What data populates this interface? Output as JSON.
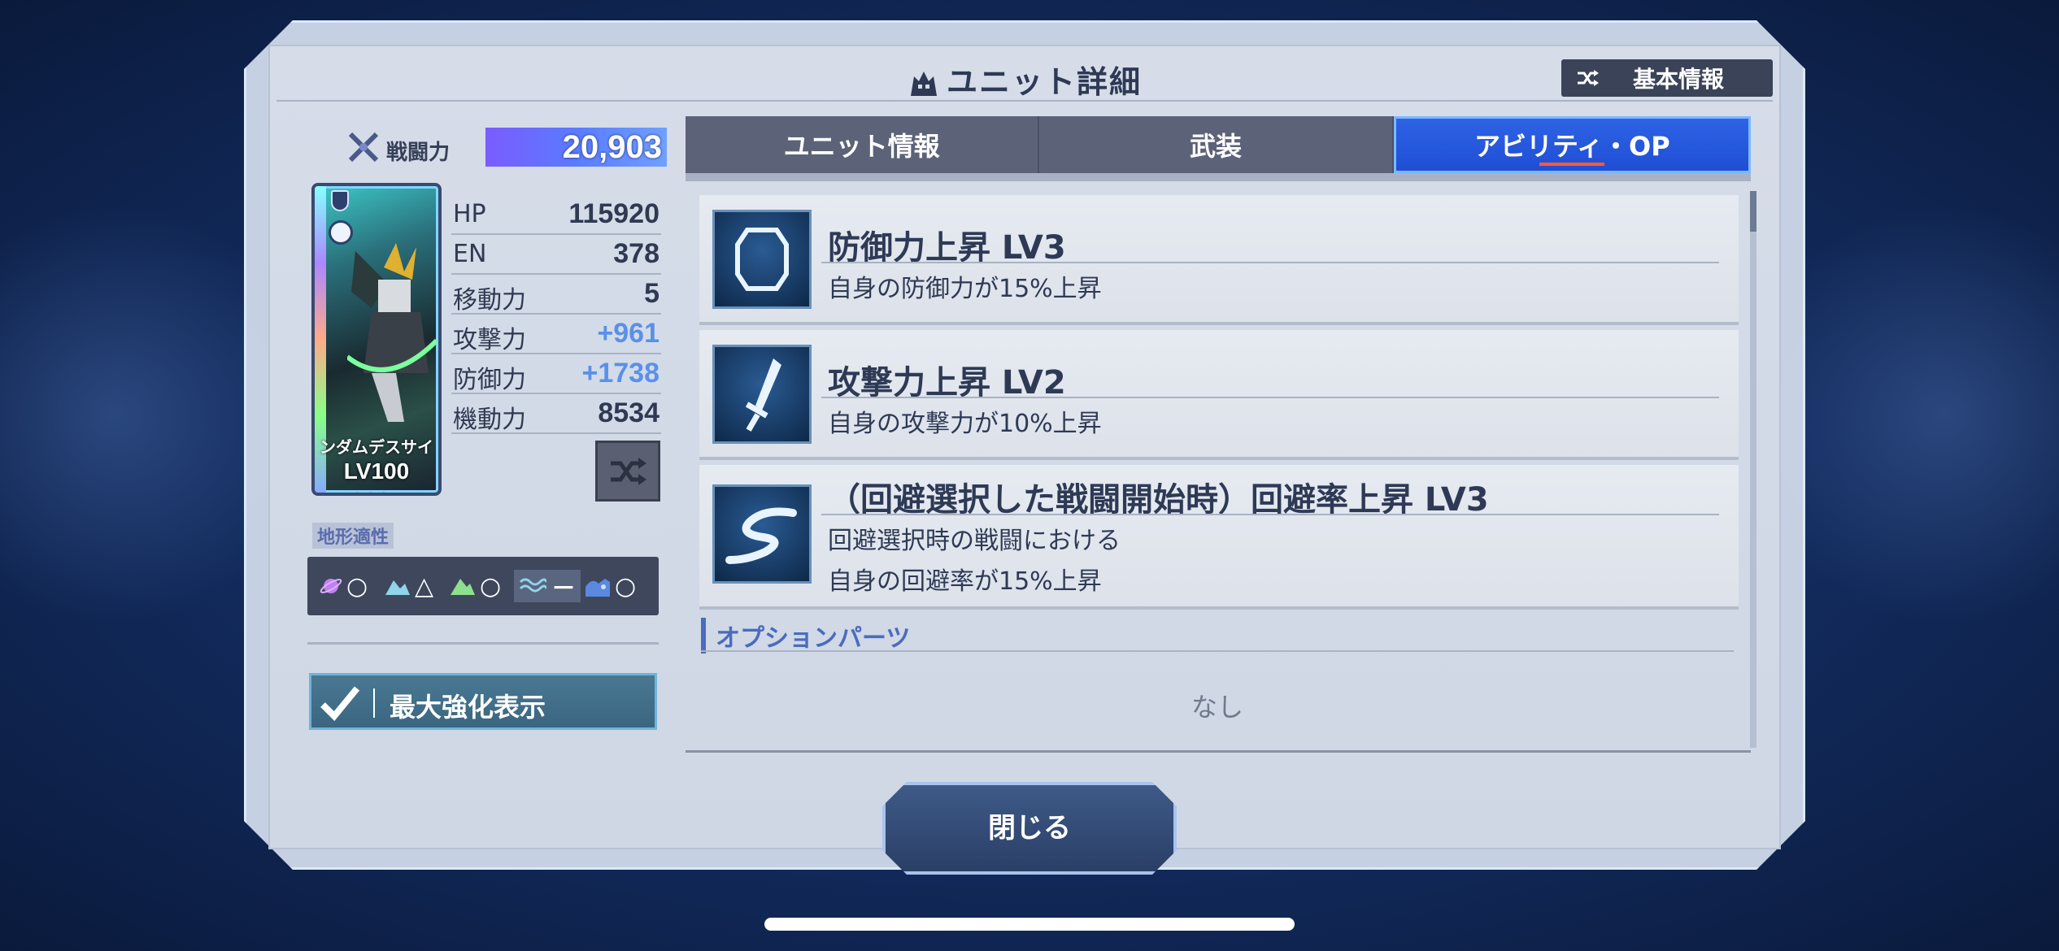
{
  "header": {
    "title": "ユニット詳細",
    "basic_info_label": "基本情報"
  },
  "power": {
    "label": "戦闘力",
    "value": "20,903"
  },
  "unit_card": {
    "name": "ンダムデスサイ",
    "level": "LV100",
    "stars": "★★★"
  },
  "stats": [
    {
      "label": "HP",
      "value": "115920",
      "bonus": false
    },
    {
      "label": "EN",
      "value": "378",
      "bonus": false
    },
    {
      "label": "移動力",
      "value": "5",
      "bonus": false
    },
    {
      "label": "攻撃力",
      "value": "+961",
      "bonus": true
    },
    {
      "label": "防御力",
      "value": "+1738",
      "bonus": true
    },
    {
      "label": "機動力",
      "value": "8534",
      "bonus": false
    }
  ],
  "terrain": {
    "title": "地形適性",
    "items": [
      {
        "icon": "space-icon",
        "rating": "○"
      },
      {
        "icon": "air-icon",
        "rating": "△"
      },
      {
        "icon": "ground-icon",
        "rating": "○"
      },
      {
        "icon": "water-icon",
        "rating": "－"
      },
      {
        "icon": "underwater-icon",
        "rating": "○"
      }
    ]
  },
  "max_button": {
    "label": "最大強化表示",
    "checked": true
  },
  "tabs": [
    {
      "label": "ユニット情報",
      "active": false
    },
    {
      "label": "武装",
      "active": false
    },
    {
      "label": "アビリティ・OP",
      "active": true
    }
  ],
  "abilities": [
    {
      "icon": "shield-icon",
      "title": "防御力上昇 LV3",
      "desc": [
        "自身の防御力が15%上昇"
      ]
    },
    {
      "icon": "sword-icon",
      "title": "攻撃力上昇 LV2",
      "desc": [
        "自身の攻撃力が10%上昇"
      ]
    },
    {
      "icon": "evade-icon",
      "title": "（回避選択した戦闘開始時）回避率上昇 LV3",
      "desc": [
        "回避選択時の戦闘における",
        "自身の回避率が15%上昇"
      ]
    }
  ],
  "options": {
    "header": "オプションパーツ",
    "none_label": "なし"
  },
  "close_button": {
    "label": "閉じる"
  },
  "colors": {
    "accent": "#1f4ed4",
    "bonus": "#5a90e8",
    "power_gradient_start": "#7a5cff",
    "active_tab_underline": "#ff5a3a"
  }
}
